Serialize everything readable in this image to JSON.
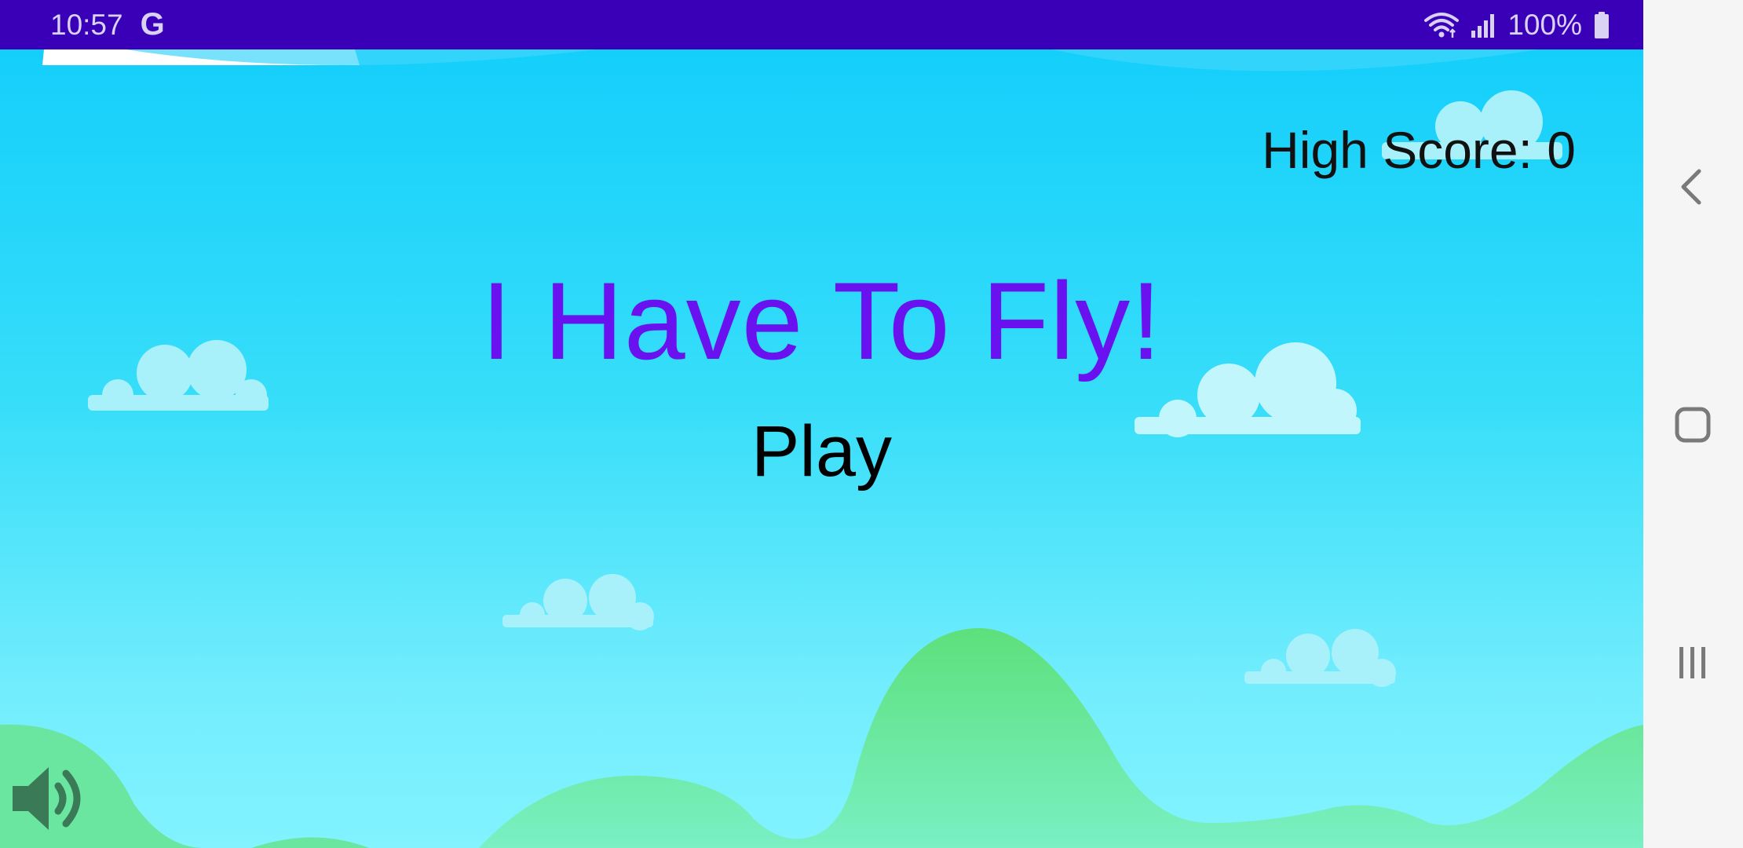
{
  "status_bar": {
    "time": "10:57",
    "g_icon_glyph": "G",
    "battery": "100%",
    "background": "#3a00b8",
    "icons": [
      "google-icon",
      "wifi-icon",
      "signal-icon",
      "battery-icon"
    ]
  },
  "game": {
    "high_score_label": "High Score: 0",
    "title": "I Have To Fly!",
    "play_label": "Play",
    "title_color": "#6a11f0",
    "sound_icon": "speaker-icon"
  },
  "nav_bar": {
    "buttons": [
      "back-icon",
      "home-icon",
      "recents-icon"
    ]
  }
}
